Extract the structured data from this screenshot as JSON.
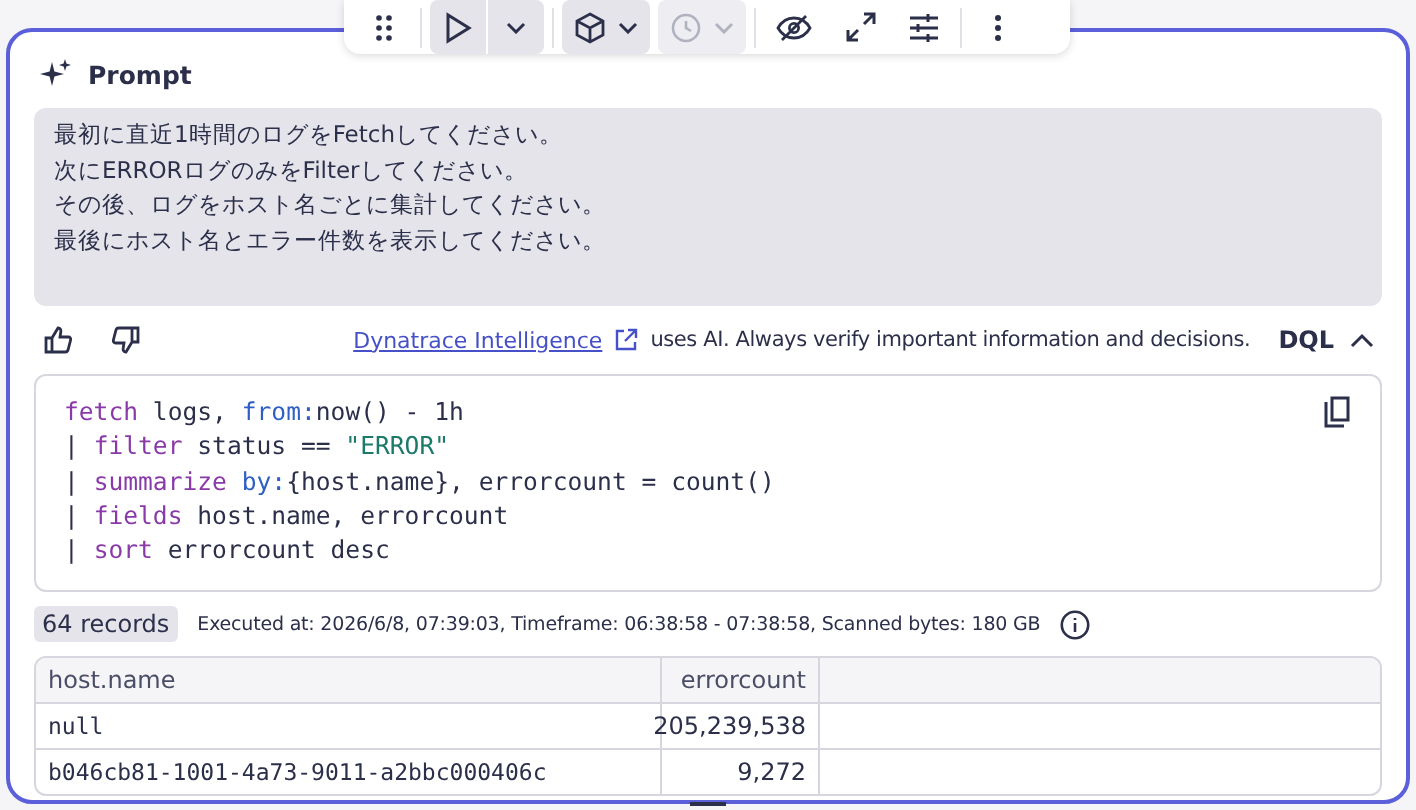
{
  "toolbar": [
    {
      "disabled": false
    },
    {
      "disabled": false
    },
    {
      "disabled": false
    },
    {
      "disabled": false
    },
    {
      "disabled": true
    },
    {
      "disabled": false
    },
    {
      "disabled": false
    },
    {
      "disabled": false
    },
    {
      "disabled": false
    }
  ],
  "prompt": {
    "title": "Prompt",
    "lines": [
      "最初に直近1時間のログをFetchしてください。",
      "次にERRORログのみをFilterしてください。",
      "その後、ログをホスト名ごとに集計してください。",
      "最後にホスト名とエラー件数を表示してください。"
    ]
  },
  "disclaimer": {
    "link": "Dynatrace Intelligence",
    "text": "uses AI. Always verify important information and decisions."
  },
  "language": {
    "label": "DQL",
    "expanded": true
  },
  "code": [
    [
      {
        "kind": "keyword",
        "text": "fetch"
      },
      {
        "kind": "plain",
        "text": " logs, "
      },
      {
        "kind": "param",
        "text": "from:"
      },
      {
        "kind": "plain",
        "text": "now() - 1h"
      }
    ],
    [
      {
        "kind": "plain",
        "text": "| "
      },
      {
        "kind": "keyword",
        "text": "filter"
      },
      {
        "kind": "plain",
        "text": " status == "
      },
      {
        "kind": "string",
        "text": "\"ERROR\""
      }
    ],
    [
      {
        "kind": "plain",
        "text": "| "
      },
      {
        "kind": "keyword",
        "text": "summarize "
      },
      {
        "kind": "param",
        "text": "by:"
      },
      {
        "kind": "plain",
        "text": "{host.name}, errorcount = count()"
      }
    ],
    [
      {
        "kind": "plain",
        "text": "| "
      },
      {
        "kind": "keyword",
        "text": "fields"
      },
      {
        "kind": "plain",
        "text": " host.name, errorcount"
      }
    ],
    [
      {
        "kind": "plain",
        "text": "| "
      },
      {
        "kind": "keyword",
        "text": "sort"
      },
      {
        "kind": "plain",
        "text": " errorcount desc"
      }
    ]
  ],
  "result": {
    "records": "64 records",
    "meta": "Executed at: 2026/6/8, 07:39:03, Timeframe: 06:38:58 - 07:38:58, Scanned bytes: 180 GB"
  },
  "table": {
    "columns": [
      "host.name",
      "errorcount"
    ],
    "rows": [
      [
        "null",
        "205,239,538"
      ],
      [
        "b046cb81-1001-4a73-9011-a2bbc000406c",
        "9,272"
      ]
    ]
  }
}
